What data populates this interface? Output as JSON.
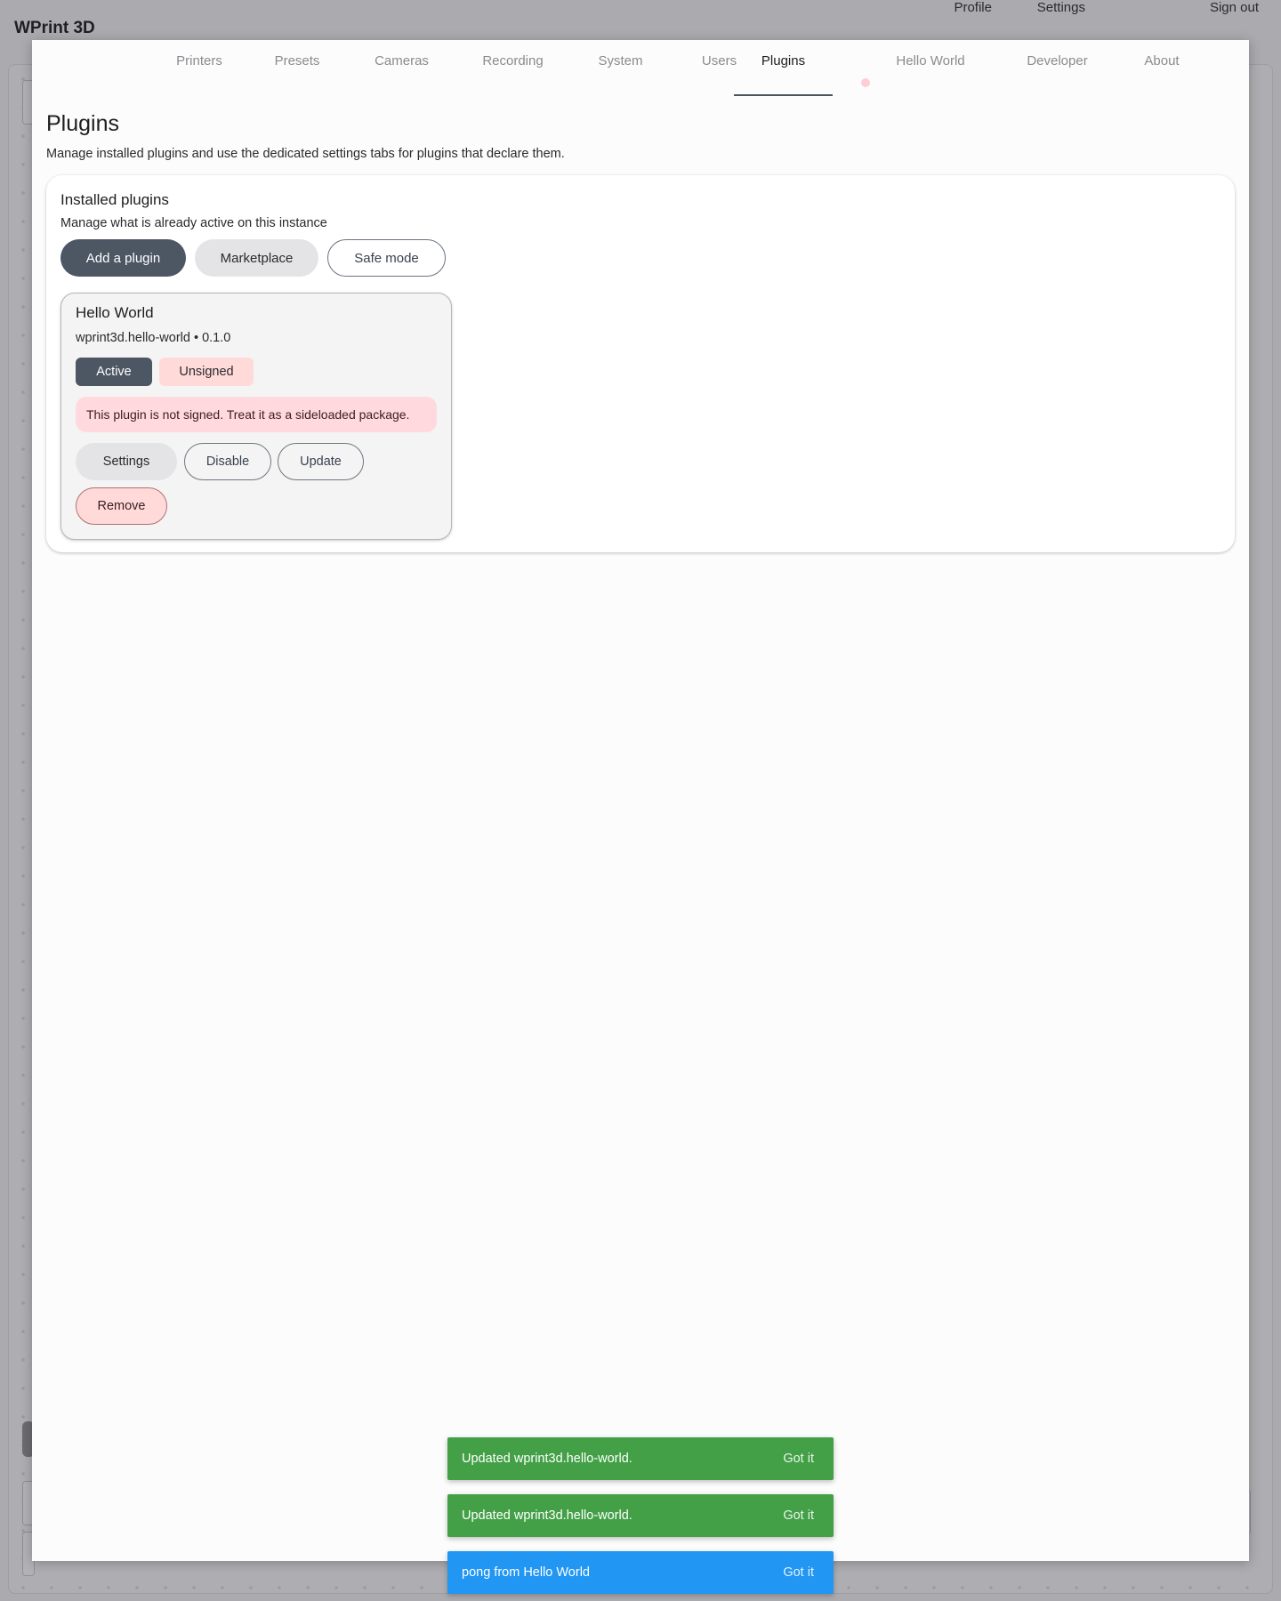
{
  "app": {
    "title": "WPrint 3D",
    "nav": [
      "Profile",
      "Settings",
      "Sign out"
    ]
  },
  "tabs": [
    {
      "label": "Printers",
      "active": false
    },
    {
      "label": "Presets",
      "active": false
    },
    {
      "label": "Cameras",
      "active": false
    },
    {
      "label": "Recording",
      "active": false
    },
    {
      "label": "System",
      "active": false
    },
    {
      "label": "Users",
      "active": false
    },
    {
      "label": "Plugins",
      "active": true
    },
    {
      "label": "Hello World",
      "active": false
    },
    {
      "label": "Developer",
      "active": false
    },
    {
      "label": "About",
      "active": false
    }
  ],
  "page": {
    "title": "Plugins",
    "subtitle": "Manage installed plugins and use the dedicated settings tabs for plugins that declare them."
  },
  "installed": {
    "title": "Installed plugins",
    "subtitle": "Manage what is already active on this instance",
    "actions": {
      "add": "Add a plugin",
      "marketplace": "Marketplace",
      "safe_mode": "Safe mode"
    },
    "plugin": {
      "name": "Hello World",
      "id_version": "wprint3d.hello-world • 0.1.0",
      "status": "Active",
      "signature": "Unsigned",
      "warning": "This plugin is not signed. Treat it as a sideloaded package.",
      "buttons": {
        "settings": "Settings",
        "disable": "Disable",
        "update": "Update",
        "remove": "Remove"
      }
    }
  },
  "toasts": [
    {
      "message": "Updated wprint3d.hello-world.",
      "action": "Got it",
      "kind": "success"
    },
    {
      "message": "Updated wprint3d.hello-world.",
      "action": "Got it",
      "kind": "success"
    },
    {
      "message": "pong from Hello World",
      "action": "Got it",
      "kind": "info"
    }
  ],
  "colors": {
    "primary": "#4d5663",
    "success": "#43a047",
    "info": "#2196f3",
    "danger_bg": "#ffdad9"
  }
}
